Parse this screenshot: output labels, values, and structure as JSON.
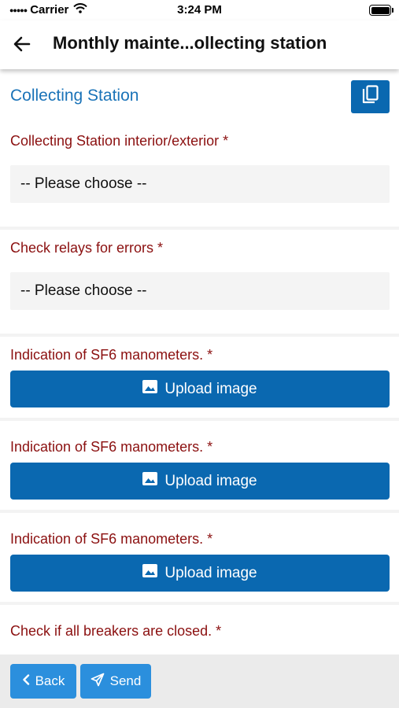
{
  "status_bar": {
    "carrier": "Carrier",
    "time": "3:24 PM"
  },
  "nav": {
    "title": "Monthly mainte...ollecting station"
  },
  "section": {
    "title": "Collecting Station"
  },
  "fields": [
    {
      "label": "Collecting Station interior/exterior *",
      "value": "-- Please choose --"
    },
    {
      "label": "Check relays for errors *",
      "value": "-- Please choose --"
    },
    {
      "label": "Indication of SF6 manometers. *",
      "button": "Upload image"
    },
    {
      "label": "Indication of SF6 manometers. *",
      "button": "Upload image"
    },
    {
      "label": "Indication of SF6 manometers. *",
      "button": "Upload image"
    },
    {
      "label": "Check if all breakers are closed. *"
    }
  ],
  "footer": {
    "back_label": "Back",
    "send_label": "Send"
  },
  "colors": {
    "primary": "#0a68b0",
    "footer_button": "#2b8fdd",
    "label": "#8b1010",
    "section_title": "#1a73b8"
  }
}
